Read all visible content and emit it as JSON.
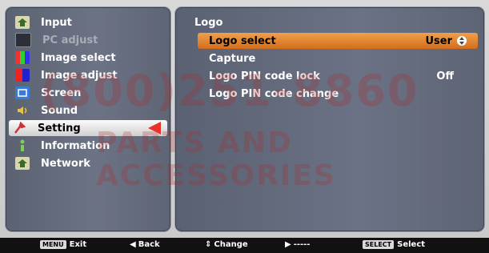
{
  "menu": {
    "items": [
      {
        "label": "Input",
        "icon": "input-icon",
        "dim": false
      },
      {
        "label": "PC adjust",
        "icon": "pc-adjust-icon",
        "dim": true
      },
      {
        "label": "Image select",
        "icon": "image-select-icon",
        "dim": false
      },
      {
        "label": "Image adjust",
        "icon": "image-adjust-icon",
        "dim": false
      },
      {
        "label": "Screen",
        "icon": "screen-icon",
        "dim": false
      },
      {
        "label": "Sound",
        "icon": "sound-icon",
        "dim": false
      },
      {
        "label": "Setting",
        "icon": "setting-icon",
        "dim": false,
        "selected": true
      },
      {
        "label": "Information",
        "icon": "information-icon",
        "dim": false
      },
      {
        "label": "Network",
        "icon": "network-icon",
        "dim": false
      }
    ]
  },
  "submenu": {
    "title": "Logo",
    "items": [
      {
        "label": "Logo select",
        "value": "User",
        "active": true
      },
      {
        "label": "Capture",
        "value": ""
      },
      {
        "label": "Logo PIN code lock",
        "value": "Off"
      },
      {
        "label": "Logo PIN code change",
        "value": ""
      }
    ]
  },
  "statusbar": {
    "exit_key": "MENU",
    "exit_label": "Exit",
    "back_label": "Back",
    "change_label": "Change",
    "next_label": "-----",
    "select_key": "SELECT",
    "select_label": "Select"
  },
  "watermark": {
    "line1": "(800)251-8860",
    "line2": "PARTS AND ACCESSORIES"
  },
  "colors": {
    "accent_orange": "#e0822e",
    "selection_arrow": "#e8322a",
    "panel_bg": "#646b7d"
  }
}
